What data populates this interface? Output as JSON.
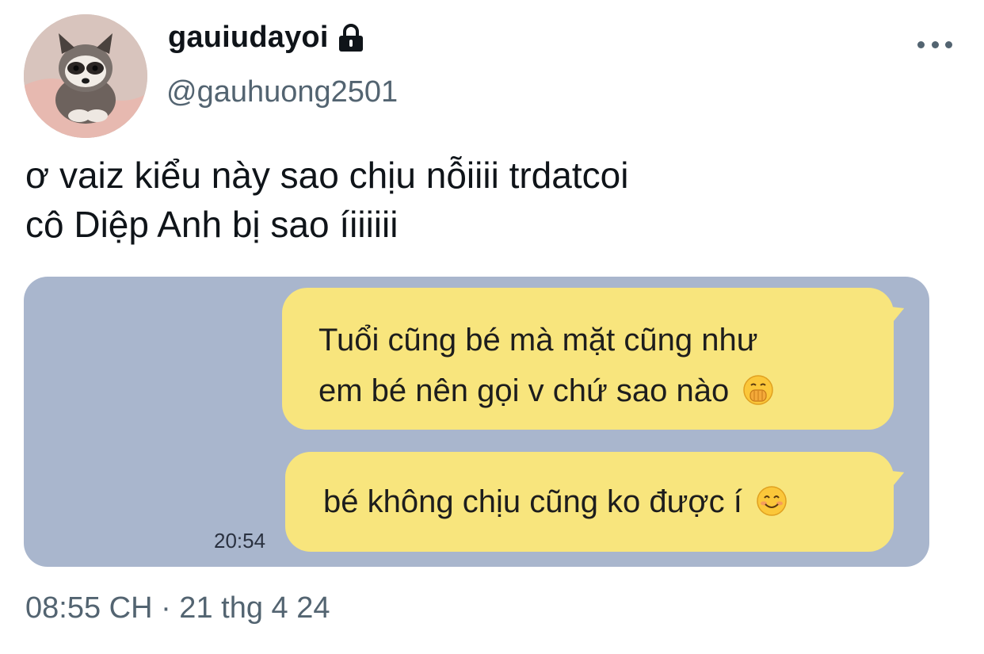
{
  "user": {
    "display_name": "gauiudayoi",
    "handle": "@gauhuong2501",
    "avatar_icon": "raccoon-avatar",
    "locked_icon": "lock-icon"
  },
  "tweet": {
    "lines": [
      "ơ vaiz kiểu này sao chịu nỗiiii trdatcoi",
      "cô Diệp Anh bị sao íiiiiii"
    ]
  },
  "media": {
    "background_color": "#a9b6cd",
    "bubble_color": "#f8e57d",
    "messages": [
      {
        "lines": [
          "Tuổi cũng bé mà mặt cũng như",
          "em bé nên gọi v chứ sao nào"
        ],
        "emoji": "hand-over-mouth-emoji"
      },
      {
        "lines": [
          "bé không chịu cũng ko được í"
        ],
        "emoji": "smiling-face-emoji"
      }
    ],
    "time": "20:54"
  },
  "footer": {
    "timestamp": "08:55 CH · 21 thg 4 24"
  }
}
